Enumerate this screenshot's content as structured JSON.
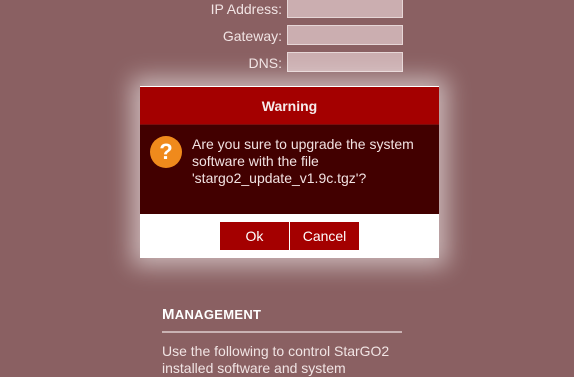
{
  "network": {
    "ip_label": "IP Address:",
    "ip_value": "",
    "gateway_label": "Gateway:",
    "gateway_value": "",
    "dns_label": "DNS:",
    "dns_value": ""
  },
  "dialog": {
    "title": "Warning",
    "icon": "question-icon",
    "icon_glyph": "?",
    "message": "Are you sure to upgrade the system software with the file 'stargo2_update_v1.9c.tgz'?",
    "ok_label": "Ok",
    "cancel_label": "Cancel"
  },
  "management": {
    "title_initial": "M",
    "title_rest": "ANAGEMENT",
    "text": "Use the following to control StarGO2 installed software and system"
  },
  "colors": {
    "background": "#8a6062",
    "dialog_header": "#a40000",
    "dialog_body": "#420000",
    "button": "#a40000",
    "icon": "#f08a1c"
  }
}
